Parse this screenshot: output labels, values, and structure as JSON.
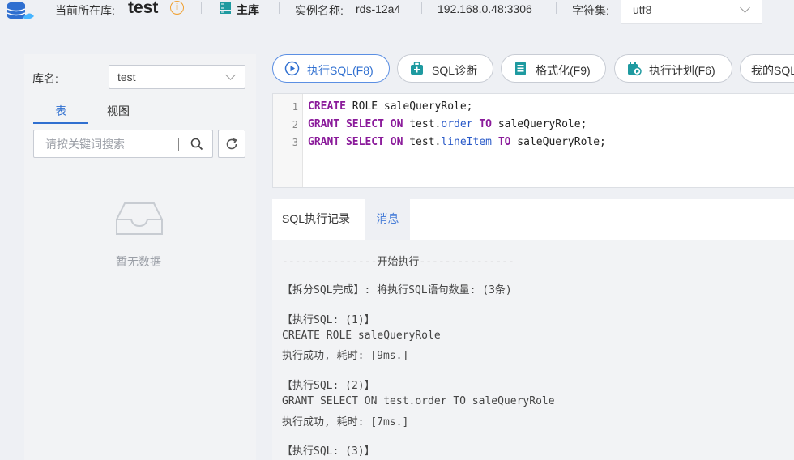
{
  "header": {
    "current_db_label": "当前所在库:",
    "current_db": "test",
    "master_label": "主库",
    "instance_label": "实例名称:",
    "instance_name": "rds-12a4",
    "address": "192.168.0.48:3306",
    "charset_label": "字符集:",
    "charset_value": "utf8"
  },
  "sidebar": {
    "db_label": "库名:",
    "db_value": "test",
    "tabs": [
      "表",
      "视图"
    ],
    "search_placeholder": "请按关键词搜索",
    "empty_text": "暂无数据"
  },
  "toolbar": {
    "buttons": [
      "执行SQL(F8)",
      "SQL诊断",
      "格式化(F9)",
      "执行计划(F6)",
      "我的SQL"
    ]
  },
  "editor": {
    "line_numbers": [
      "1",
      "2",
      "3"
    ],
    "lines": [
      [
        [
          "kw",
          "CREATE"
        ],
        [
          "t",
          " ROLE saleQueryRole;"
        ]
      ],
      [
        [
          "kw",
          "GRANT SELECT ON"
        ],
        [
          "t",
          " test."
        ],
        [
          "id",
          "order"
        ],
        [
          "t",
          " "
        ],
        [
          "kw",
          "TO"
        ],
        [
          "t",
          " saleQueryRole;"
        ]
      ],
      [
        [
          "kw",
          "GRANT SELECT ON"
        ],
        [
          "t",
          " test."
        ],
        [
          "id",
          "lineItem"
        ],
        [
          "t",
          " "
        ],
        [
          "kw",
          "TO"
        ],
        [
          "t",
          " saleQueryRole;"
        ]
      ]
    ]
  },
  "output": {
    "tabs": [
      "SQL执行记录",
      "消息"
    ],
    "active_tab": 1,
    "messages": [
      "---------------开始执行---------------",
      "【拆分SQL完成】: 将执行SQL语句数量: (3条)",
      "【执行SQL: (1)】",
      "CREATE ROLE saleQueryRole",
      "执行成功, 耗时: [9ms.]",
      "【执行SQL: (2)】",
      "GRANT SELECT ON test.order TO saleQueryRole",
      "执行成功, 耗时: [7ms.]",
      "【执行SQL: (3)】"
    ]
  }
}
